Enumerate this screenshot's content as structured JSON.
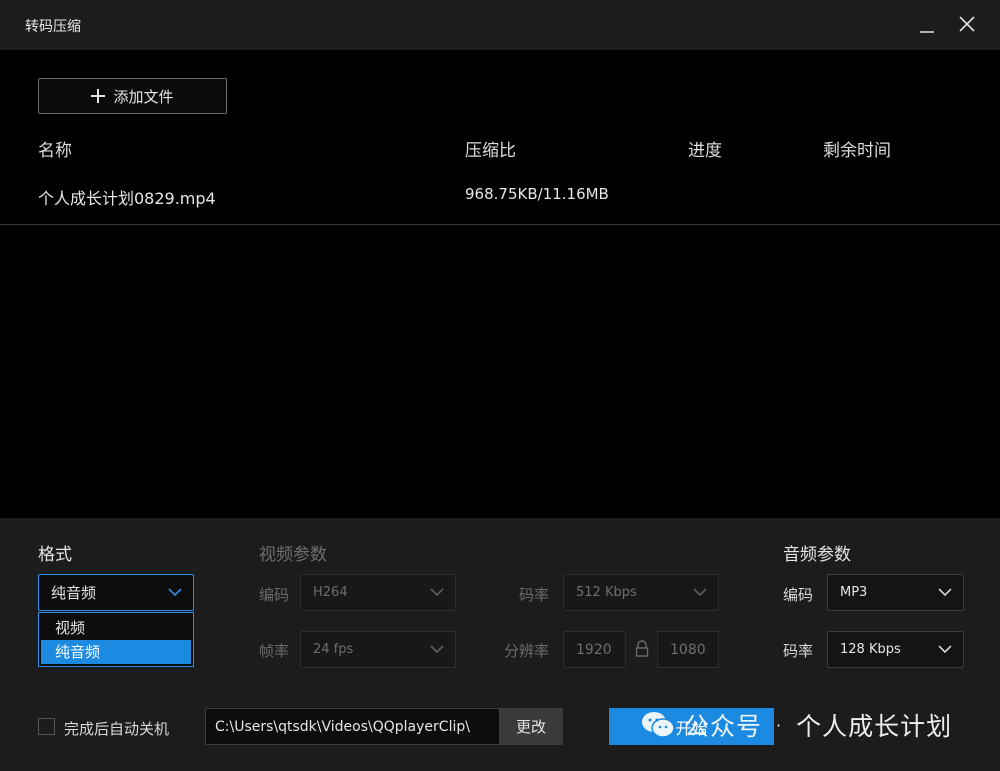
{
  "window": {
    "title": "转码压缩"
  },
  "toolbar": {
    "add_file_label": "添加文件"
  },
  "table": {
    "columns": [
      "名称",
      "压缩比",
      "进度",
      "剩余时间"
    ],
    "rows": [
      {
        "name": "个人成长计划0829.mp4",
        "ratio": "968.75KB/11.16MB",
        "progress": "",
        "remaining": ""
      }
    ]
  },
  "format": {
    "title": "格式",
    "selected": "纯音频",
    "options": [
      "视频",
      "纯音频"
    ]
  },
  "video_params": {
    "title": "视频参数",
    "codec_label": "编码",
    "codec_value": "H264",
    "bitrate_label": "码率",
    "bitrate_value": "512 Kbps",
    "fps_label": "帧率",
    "fps_value": "24 fps",
    "resolution_label": "分辨率",
    "width": "1920",
    "height": "1080"
  },
  "audio_params": {
    "title": "音频参数",
    "codec_label": "编码",
    "codec_value": "MP3",
    "bitrate_label": "码率",
    "bitrate_value": "128 Kbps"
  },
  "footer": {
    "auto_shutdown_label": "完成后自动关机",
    "output_path": "C:\\Users\\qtsdk\\Videos\\QQplayerClip\\",
    "change_label": "更改",
    "start_label": "开始"
  },
  "watermark": {
    "text_left": "公众号",
    "separator": "·",
    "text_right": "个人成长计划"
  },
  "colors": {
    "accent": "#1b8ae0",
    "background": "#000000",
    "panel": "#1c1c1c"
  }
}
